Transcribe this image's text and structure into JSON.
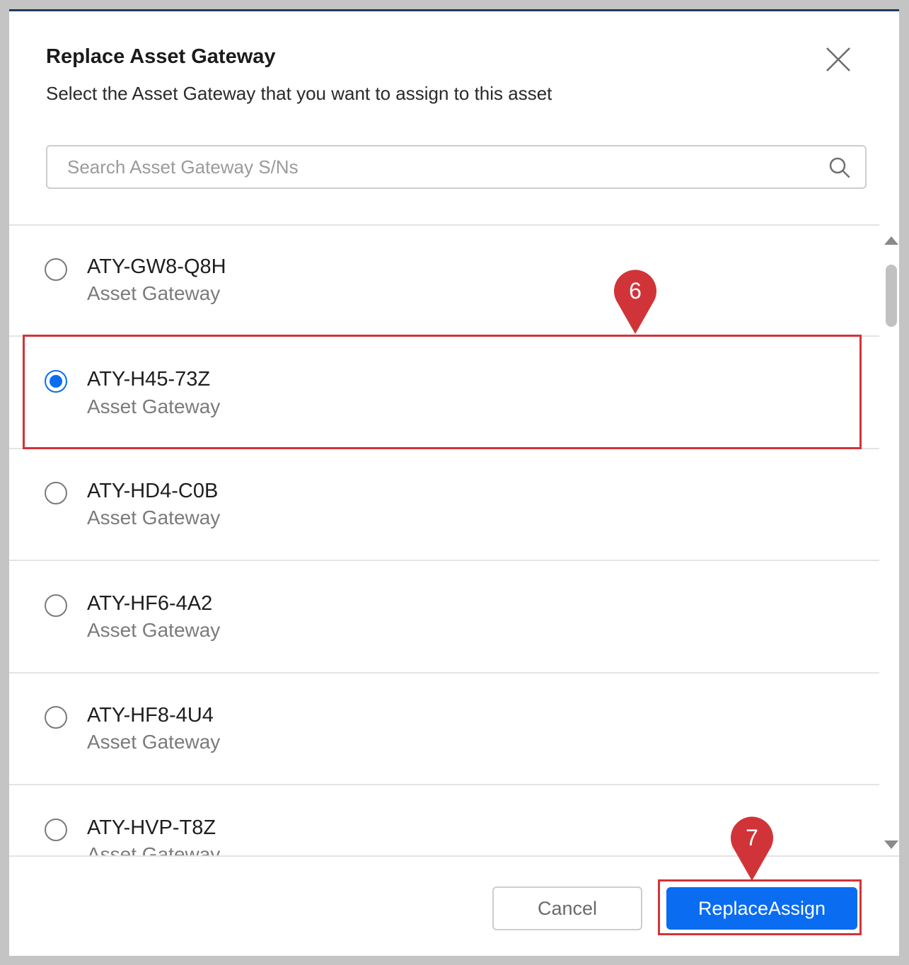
{
  "dialog": {
    "title": "Replace Asset Gateway",
    "subtitle": "Select the Asset Gateway that you want to assign to this asset",
    "close_icon": "close-icon"
  },
  "search": {
    "placeholder": "Search Asset Gateway S/Ns",
    "value": "",
    "icon": "search-icon"
  },
  "gateways": [
    {
      "serial": "ATY-GW8-Q8H",
      "type": "Asset Gateway",
      "selected": false
    },
    {
      "serial": "ATY-H45-73Z",
      "type": "Asset Gateway",
      "selected": true
    },
    {
      "serial": "ATY-HD4-C0B",
      "type": "Asset Gateway",
      "selected": false
    },
    {
      "serial": "ATY-HF6-4A2",
      "type": "Asset Gateway",
      "selected": false
    },
    {
      "serial": "ATY-HF8-4U4",
      "type": "Asset Gateway",
      "selected": false
    },
    {
      "serial": "ATY-HVP-T8Z",
      "type": "Asset Gateway",
      "selected": false
    }
  ],
  "footer": {
    "cancel_label": "Cancel",
    "primary_label": "ReplaceAssign"
  },
  "annotations": {
    "step_a": "6",
    "step_b": "7",
    "color": "#d13438"
  },
  "colors": {
    "accent": "#0a6cf0",
    "header_border": "#1f3a5c",
    "backdrop": "#c4c4c4"
  }
}
